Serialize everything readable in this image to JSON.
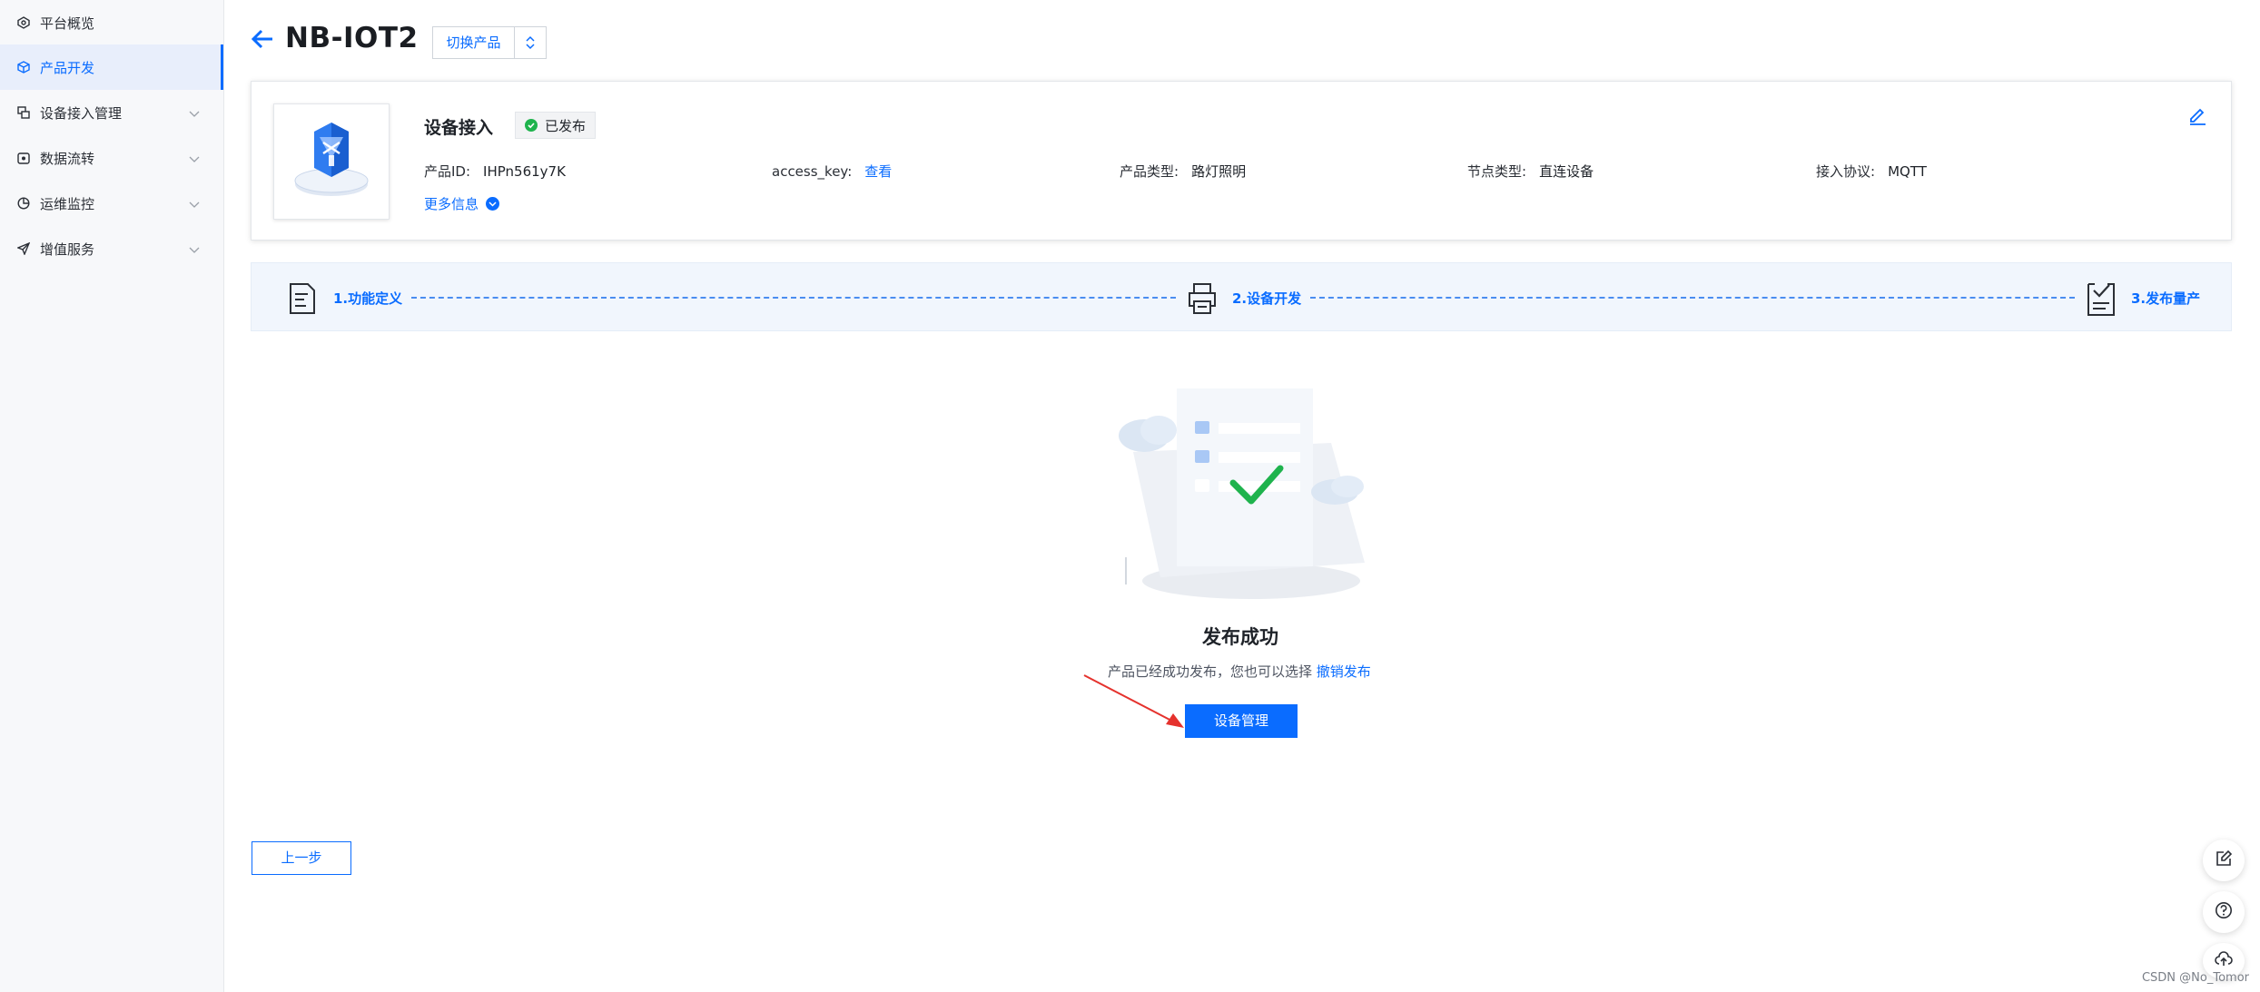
{
  "sidebar": {
    "items": [
      {
        "label": "平台概览",
        "icon": "dashboard-icon",
        "active": false,
        "expandable": false
      },
      {
        "label": "产品开发",
        "icon": "cube-icon",
        "active": true,
        "expandable": false
      },
      {
        "label": "设备接入管理",
        "icon": "device-icon",
        "active": false,
        "expandable": true
      },
      {
        "label": "数据流转",
        "icon": "dataflow-icon",
        "active": false,
        "expandable": true
      },
      {
        "label": "运维监控",
        "icon": "pie-chart-icon",
        "active": false,
        "expandable": true
      },
      {
        "label": "增值服务",
        "icon": "send-icon",
        "active": false,
        "expandable": true
      }
    ]
  },
  "header": {
    "title": "NB-IOT2",
    "switch_label": "切换产品"
  },
  "product": {
    "name": "设备接入",
    "status": "已发布",
    "id_label": "产品ID:",
    "id_value": "IHPn561y7K",
    "access_key_label": "access_key:",
    "access_key_link": "查看",
    "type_label": "产品类型:",
    "type_value": "路灯照明",
    "node_label": "节点类型:",
    "node_value": "直连设备",
    "protocol_label": "接入协议:",
    "protocol_value": "MQTT",
    "more_info": "更多信息"
  },
  "steps": [
    {
      "label": "1.功能定义",
      "icon": "document-edit-icon"
    },
    {
      "label": "2.设备开发",
      "icon": "printer-icon"
    },
    {
      "label": "3.发布量产",
      "icon": "checklist-icon"
    }
  ],
  "result": {
    "title": "发布成功",
    "desc": "产品已经成功发布，您也可以选择",
    "revoke_link": "撤销发布",
    "primary_button": "设备管理"
  },
  "footer": {
    "prev_button": "上一步"
  },
  "watermark": "CSDN @No_Tomor",
  "colors": {
    "accent": "#0a6cff",
    "success": "#1fb34d",
    "annotation_arrow": "#e5322d"
  }
}
